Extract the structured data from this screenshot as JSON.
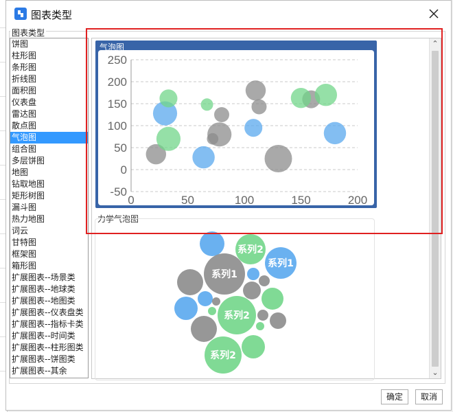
{
  "dialog": {
    "title": "图表类型",
    "ok_label": "确定",
    "cancel_label": "取消"
  },
  "group_label": "图表类型",
  "chart_types": [
    "饼图",
    "柱形图",
    "条形图",
    "折线图",
    "面积图",
    "仪表盘",
    "雷达图",
    "散点图",
    "气泡图",
    "组合图",
    "多层饼图",
    "地图",
    "钻取地图",
    "矩形树图",
    "漏斗图",
    "热力地图",
    "词云",
    "甘特图",
    "框架图",
    "箱形图",
    "扩展图表--场景类",
    "扩展图表--地球类",
    "扩展图表--地图类",
    "扩展图表--仪表盘类",
    "扩展图表--指标卡类",
    "扩展图表--时间类",
    "扩展图表--柱形图类",
    "扩展图表--饼图类",
    "扩展图表--其余"
  ],
  "selected_index": 8,
  "preview": {
    "card1_title": "气泡图",
    "card2_title": "力学气泡图",
    "scroll_up": "⌃",
    "scroll_down": "⌄"
  },
  "colors": {
    "blue": "#5aa8ee",
    "green": "#72d68a",
    "gray": "#8c8c8c",
    "accent": "#3864a8",
    "highlight": "#e02020"
  },
  "chart_data": [
    {
      "type": "scatter",
      "subtype": "bubble",
      "title": "气泡图",
      "xlim": [
        0,
        200
      ],
      "ylim": [
        -50,
        250
      ],
      "xticks": [
        0,
        50,
        100,
        150,
        200
      ],
      "yticks": [
        -50,
        0,
        50,
        100,
        150,
        200,
        250
      ],
      "grid": "horizontal dashed",
      "series": [
        {
          "color": "gray",
          "points": [
            {
              "x": 130,
              "y": 25,
              "size": 4
            },
            {
              "x": 78,
              "y": 80,
              "size": 3
            },
            {
              "x": 110,
              "y": 180,
              "size": 2
            },
            {
              "x": 113,
              "y": 143,
              "size": 1
            },
            {
              "x": 80,
              "y": 125,
              "size": 1
            },
            {
              "x": 22,
              "y": 35,
              "size": 2
            },
            {
              "x": 72,
              "y": 70,
              "size": 0.5
            },
            {
              "x": 159,
              "y": 160,
              "size": 1.5
            }
          ]
        },
        {
          "color": "blue",
          "points": [
            {
              "x": 30,
              "y": 128,
              "size": 3
            },
            {
              "x": 64,
              "y": 28,
              "size": 2.5
            },
            {
              "x": 108,
              "y": 95,
              "size": 1.5
            },
            {
              "x": 180,
              "y": 83,
              "size": 2.5
            }
          ]
        },
        {
          "color": "green",
          "points": [
            {
              "x": 33,
              "y": 70,
              "size": 3
            },
            {
              "x": 33,
              "y": 162,
              "size": 1.5
            },
            {
              "x": 150,
              "y": 163,
              "size": 2
            },
            {
              "x": 172,
              "y": 170,
              "size": 2.5
            },
            {
              "x": 67,
              "y": 148,
              "size": 0.6
            }
          ]
        }
      ]
    },
    {
      "type": "scatter",
      "subtype": "force-bubble",
      "title": "力学气泡图",
      "series": [
        {
          "name": "系列1",
          "color": "gray"
        },
        {
          "name": "系列2",
          "color": "green"
        },
        {
          "name": "系列1",
          "color": "blue"
        }
      ],
      "labels": [
        "系列2",
        "系列1",
        "系列1",
        "系列2",
        "系列2"
      ]
    }
  ]
}
